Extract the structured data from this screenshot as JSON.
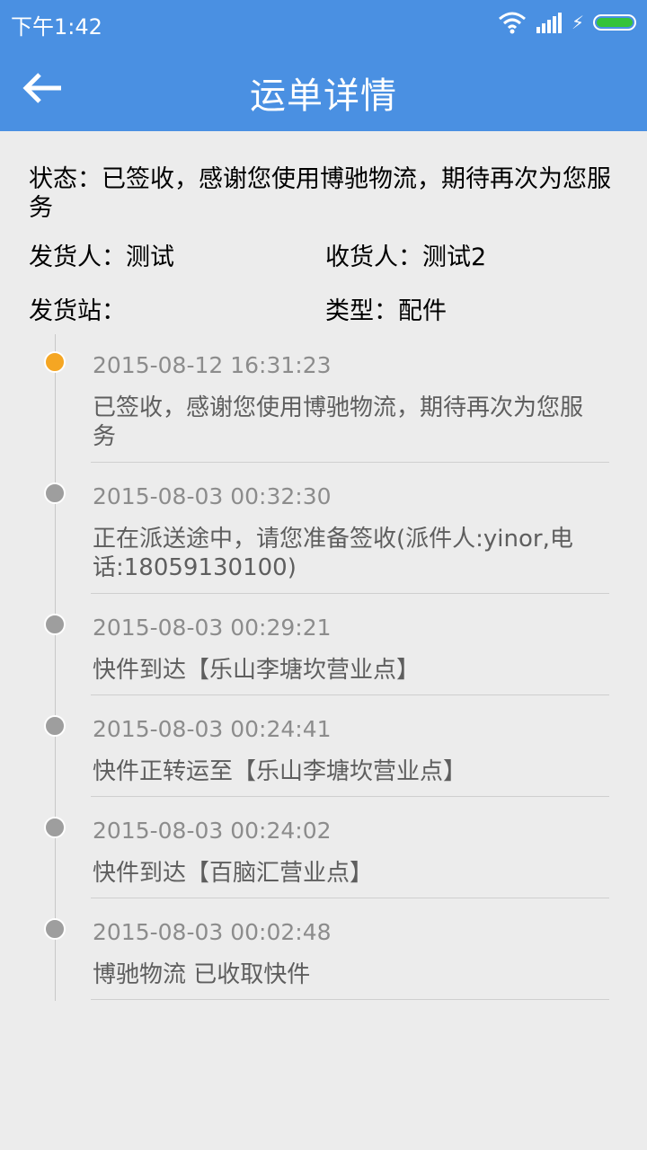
{
  "statusbar": {
    "time": "下午1:42",
    "icons": [
      "wifi-icon",
      "signal-icon",
      "charging-icon",
      "battery-icon"
    ],
    "battery_color": "#35c33a"
  },
  "appbar": {
    "title": "运单详情",
    "back_icon": "arrow-left-icon",
    "color": "#4a90e2"
  },
  "info": {
    "status_text": "状态：已签收，感谢您使用博驰物流，期待再次为您服务",
    "shipper": "发货人：测试",
    "receiver": "收货人：测试2",
    "station": "发货站：",
    "type": "类型：配件"
  },
  "timeline": [
    {
      "time": "2015-08-12 16:31:23",
      "text": "已签收，感谢您使用博驰物流，期待再次为您服务",
      "current": true
    },
    {
      "time": "2015-08-03 00:32:30",
      "text": "正在派送途中，请您准备签收(派件人:yinor,电话:18059130100)",
      "current": false
    },
    {
      "time": "2015-08-03 00:29:21",
      "text": "快件到达【乐山李塘坎营业点】",
      "current": false
    },
    {
      "time": "2015-08-03 00:24:41",
      "text": "快件正转运至【乐山李塘坎营业点】",
      "current": false
    },
    {
      "time": "2015-08-03 00:24:02",
      "text": "快件到达【百脑汇营业点】",
      "current": false
    },
    {
      "time": "2015-08-03 00:02:48",
      "text": "博驰物流 已收取快件",
      "current": false
    }
  ],
  "colors": {
    "current_dot": "#f5a623",
    "past_dot": "#9e9e9e"
  }
}
